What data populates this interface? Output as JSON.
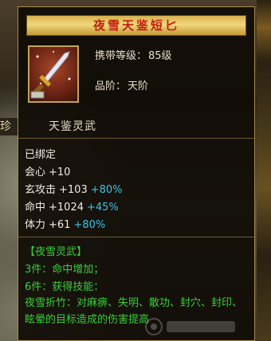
{
  "background": {
    "left_tab_text": "珍"
  },
  "item": {
    "title": "夜雪天鉴短匕",
    "icon": "dagger-icon",
    "level_label": "携带等级：",
    "level_value": "85级",
    "grade_label": "品阶：",
    "grade_value": "天阶",
    "subname": "天鉴灵武"
  },
  "binding": "已绑定",
  "stats": [
    {
      "name": "会心",
      "value": "+10",
      "bonus": ""
    },
    {
      "name": "玄攻击",
      "value": "+103",
      "bonus": "+80%"
    },
    {
      "name": "命中",
      "value": "+1024",
      "bonus": "+45%"
    },
    {
      "name": "体力",
      "value": "+61",
      "bonus": "+80%"
    }
  ],
  "set": {
    "name": "【夜雪灵武】",
    "bonus_3": "3件：命中增加；",
    "bonus_6": "6件：获得技能：",
    "skill_desc": "夜雪折竹：对麻痹、失明、散功、封穴、封印、眩晕的目标造成的伤害提高"
  },
  "colors": {
    "title_text": "#c41e14",
    "title_bg": "#f1d77c",
    "bonus": "#39c4e6",
    "set_green": "#38d038"
  }
}
